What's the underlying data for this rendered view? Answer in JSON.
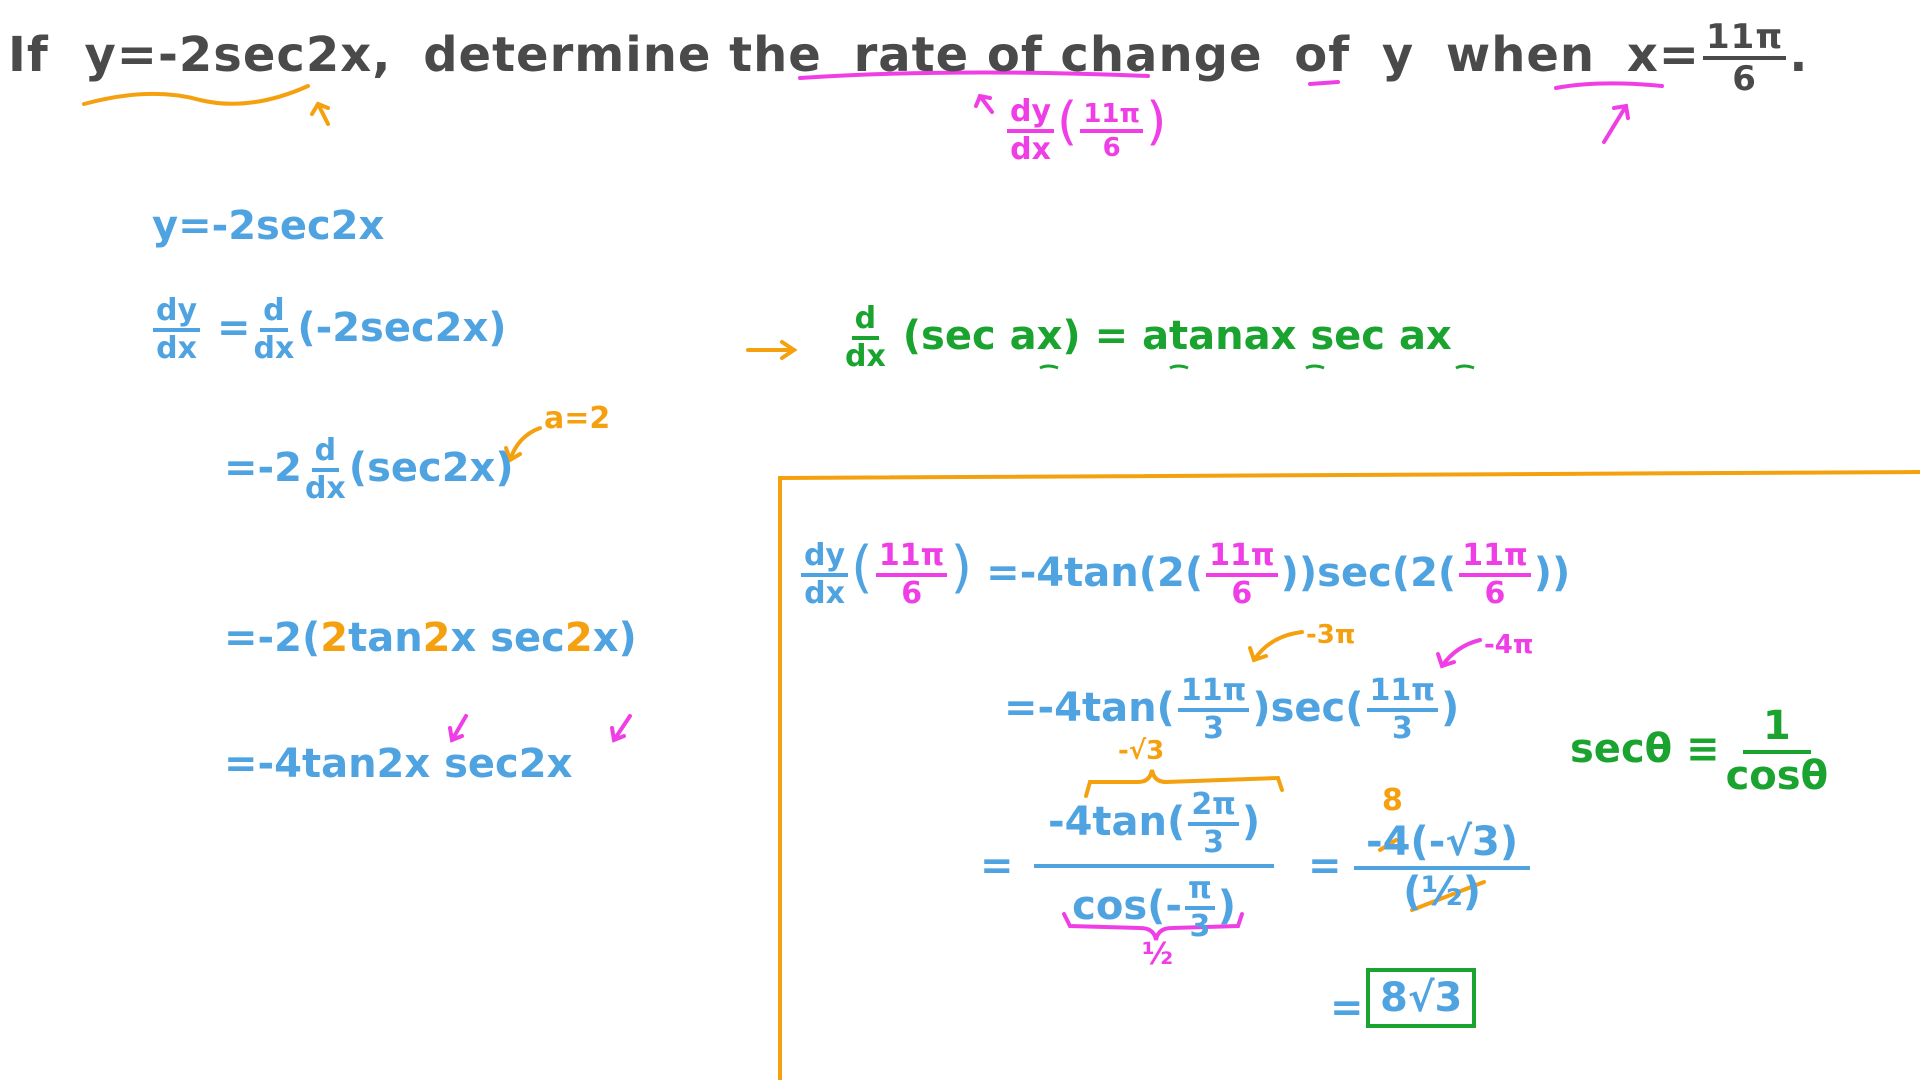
{
  "question": {
    "if": "If",
    "equation": "y=-2sec2x,",
    "text1": "determine the",
    "rate_of_change": "rate of change",
    "of": "of",
    "y": "y",
    "when": "when",
    "x_eq": "x=",
    "x_num": "11π",
    "x_den": "6",
    "period": "."
  },
  "annotation_top": {
    "dy": "dy",
    "dx": "dx",
    "arg_num": "11π",
    "arg_den": "6"
  },
  "steps": {
    "s1": "y=-2sec2x",
    "s2_lhs_num": "dy",
    "s2_lhs_den": "dx",
    "s2_eq": "=",
    "s2_d_num": "d",
    "s2_d_den": "dx",
    "s2_rest": "(-2sec2x)",
    "s3_pre": "=-2",
    "s3_d_num": "d",
    "s3_d_den": "dx",
    "s3_rest": "(sec2x)",
    "s3_note": "a=2",
    "s4_pre": "=-2(",
    "s4_two1": "2",
    "s4_tan": "tan",
    "s4_two2": "2",
    "s4_mid": "x sec",
    "s4_two3": "2",
    "s4_end": "x)",
    "s5": "=-4tan2x sec2x"
  },
  "rule": {
    "d_num": "d",
    "d_den": "dx",
    "text_a": "(sec ax) = atanax sec ax"
  },
  "box": {
    "l1_lhs_num": "dy",
    "l1_lhs_den": "dx",
    "l1_arg_num": "11π",
    "l1_arg_den": "6",
    "l1_eq": "=-4tan(2(",
    "l1_mid": "))sec(2(",
    "l1_end": "))",
    "note_a": "-3π",
    "note_b": "-4π",
    "l2_eq": "=-4tan(",
    "l2_num": "11π",
    "l2_den": "3",
    "l2_mid": ")sec(",
    "l2_num2": "11π",
    "l2_den2": "3",
    "l2_end": ")",
    "brace_top_label": "-√3",
    "l3_eq": "=",
    "l3_top": "-4tan(",
    "l3_top_num": "2π",
    "l3_top_den": "3",
    "l3_top_end": ")",
    "l3_bot": "cos(-",
    "l3_bot_num": "π",
    "l3_bot_den": "3",
    "l3_bot_end": ")",
    "brace_bot_label": "½",
    "l3_eq2": "=",
    "l3_r_top": "-4(-√3)",
    "l3_r_bot": "(½)",
    "l3_r_over": "8",
    "final_eq": "=",
    "final": "8√3"
  },
  "identity": {
    "lhs": "secθ ≡",
    "num": "1",
    "den": "cosθ"
  },
  "colors": {
    "dark": "#4a4a4a",
    "blue": "#4fa3e0",
    "pink": "#f03ee6",
    "orange": "#f5a00f",
    "green": "#1aa32e"
  }
}
